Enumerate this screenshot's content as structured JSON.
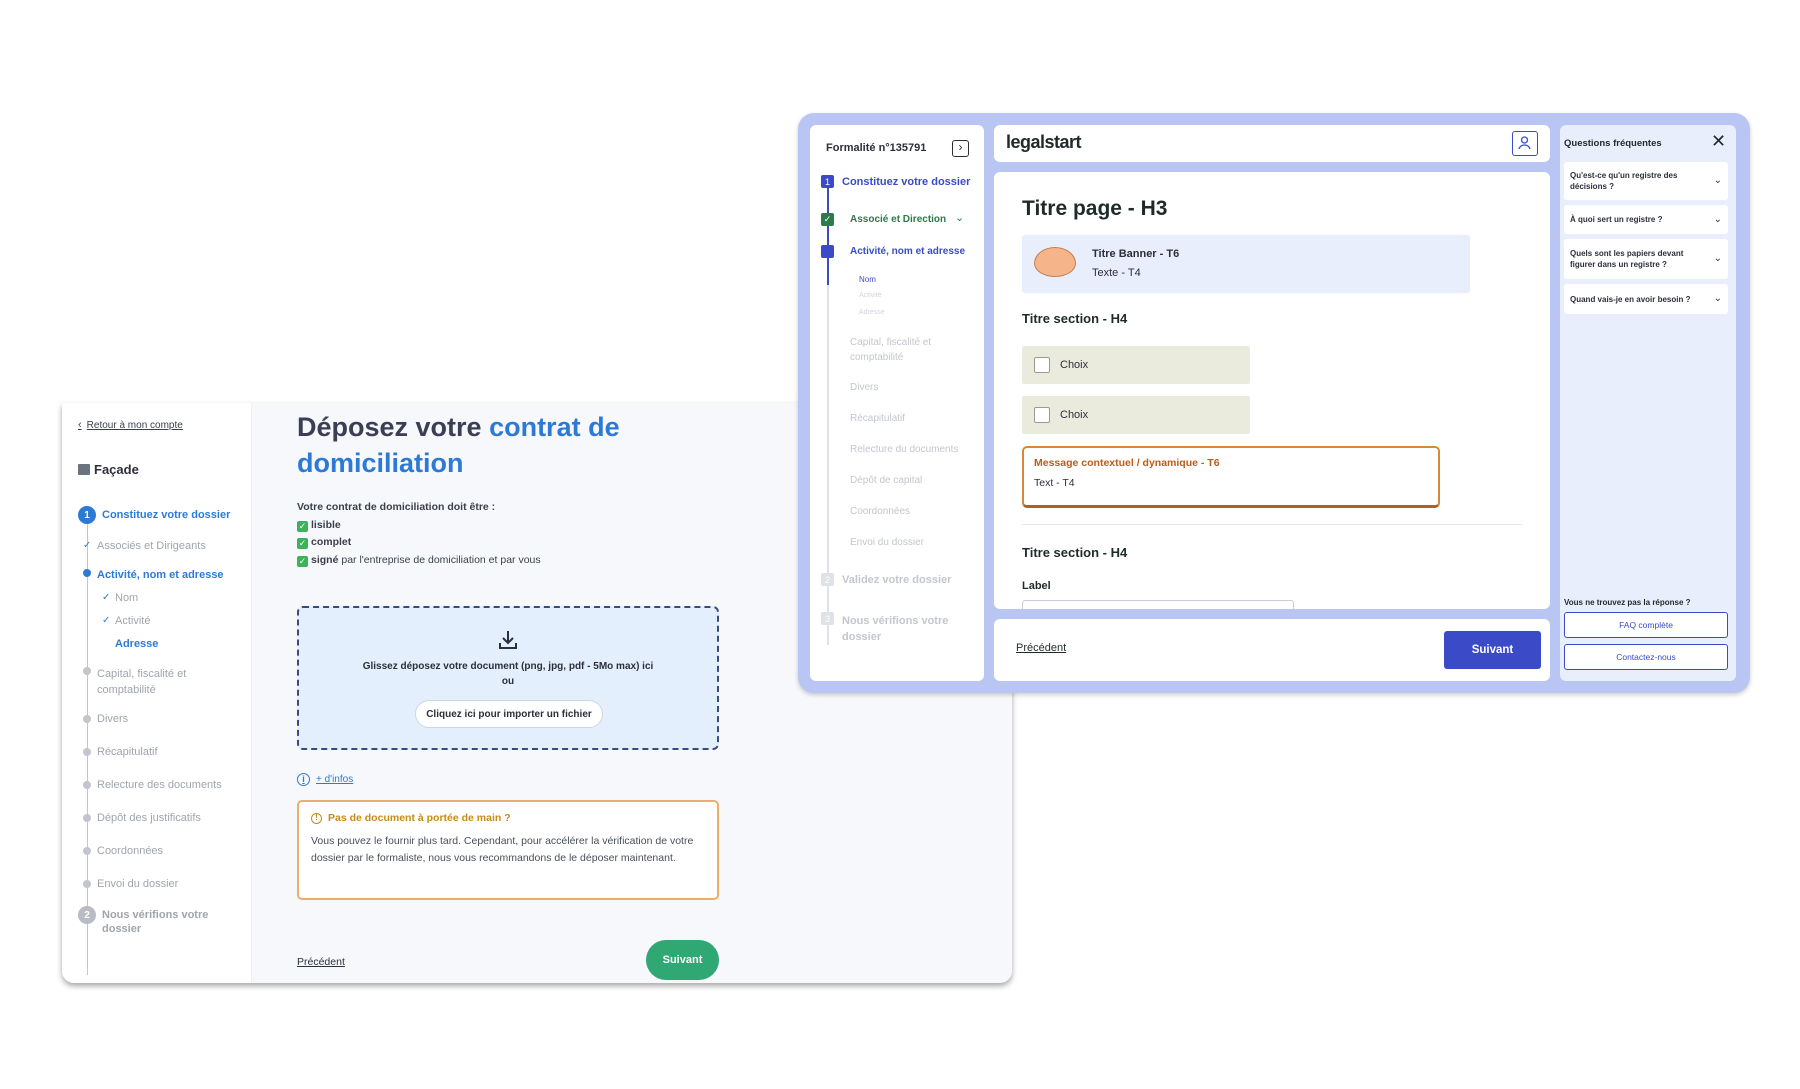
{
  "back": {
    "back_link": "Retour à mon compte",
    "company": "Façade",
    "steps": [
      {
        "num": "1",
        "label": "Constituez votre dossier"
      },
      {
        "label": "Associés et Dirigeants"
      },
      {
        "label": "Activité, nom et adresse"
      },
      {
        "label": "Nom"
      },
      {
        "label": "Activité"
      },
      {
        "label": "Adresse"
      },
      {
        "label": "Capital, fiscalité et comptabilité"
      },
      {
        "label": "Divers"
      },
      {
        "label": "Récapitulatif"
      },
      {
        "label": "Relecture des documents"
      },
      {
        "label": "Dépôt des justificatifs"
      },
      {
        "label": "Coordonnées"
      },
      {
        "label": "Envoi du dossier"
      },
      {
        "num": "2",
        "label": "Nous vérifions votre dossier"
      }
    ],
    "title_part1": "Déposez votre ",
    "title_part2": "contrat de domiciliation",
    "intro": "Votre contrat de domiciliation doit être :",
    "requirements": [
      {
        "bold": "lisible",
        "rest": ""
      },
      {
        "bold": "complet",
        "rest": ""
      },
      {
        "bold": "signé",
        "rest": " par l'entreprise de domiciliation et par vous"
      }
    ],
    "drop_text": "Glissez déposez votre document (png, jpg, pdf - 5Mo max) ici",
    "drop_or": "ou",
    "import_button": "Cliquez ici pour importer un fichier",
    "more_info": "+ d'infos",
    "warning_title": "Pas de document à portée de main ?",
    "warning_body": "Vous pouvez le fournir plus tard. Cependant, pour accélérer la vérification de votre dossier par le formaliste, nous vous recommandons de le déposer maintenant.",
    "prev": "Précédent",
    "next": "Suivant"
  },
  "front": {
    "formality": "Formalité n°135791",
    "steps": [
      {
        "num": "1",
        "label": "Constituez votre dossier"
      },
      {
        "label": "Associé et Direction"
      },
      {
        "label": "Activité, nom et adresse"
      },
      {
        "label": "Nom"
      },
      {
        "label": "Activité"
      },
      {
        "label": "Adresse"
      },
      {
        "label": "Capital, fiscalité et comptabilité"
      },
      {
        "label": "Divers"
      },
      {
        "label": "Récapitulatif"
      },
      {
        "label": "Relecture du documents"
      },
      {
        "label": "Dépôt de capital"
      },
      {
        "label": "Coordonnées"
      },
      {
        "label": "Envoi du dossier"
      },
      {
        "num": "2",
        "label": "Validez votre dossier"
      },
      {
        "num": "3",
        "label": "Nous vérifions votre dossier"
      }
    ],
    "logo": "legalstart",
    "page_title": "Titre page - H3",
    "banner_title": "Titre Banner - T6",
    "banner_text": "Texte - T4",
    "section1": "Titre section - H4",
    "choice1": "Choix",
    "choice2": "Choix",
    "ctx_title": "Message contextuel / dynamique - T6",
    "ctx_text": "Text - T4",
    "section2": "Titre section - H4",
    "label": "Label",
    "prev": "Précédent",
    "next": "Suivant",
    "faq_title": "Questions fréquentes",
    "faq": [
      "Qu'est-ce qu'un registre des décisions ?",
      "À quoi sert un registre ?",
      "Quels sont les papiers devant figurer dans un registre ?",
      "Quand vais-je en avoir besoin ?"
    ],
    "faq_missing": "Vous ne trouvez pas la réponse ?",
    "faq_full": "FAQ complète",
    "contact": "Contactez-nous"
  },
  "colors": {
    "accent_blue": "#2d7ad6",
    "indigo": "#3b4bc8",
    "green": "#2fa873",
    "warning": "#e9b06b",
    "frame": "#b9c6f3"
  }
}
